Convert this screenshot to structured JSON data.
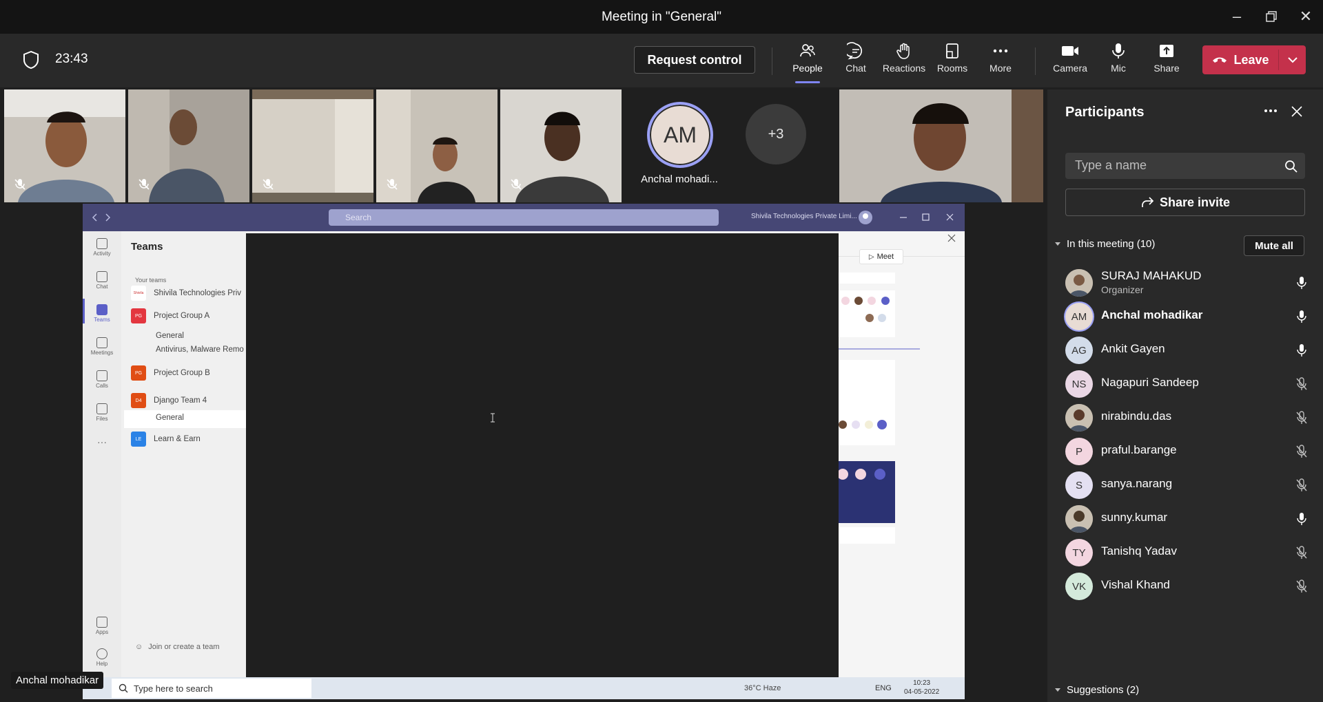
{
  "window": {
    "title": "Meeting in \"General\""
  },
  "meeting_bar": {
    "timer": "23:43",
    "request_control": "Request control",
    "tools": [
      {
        "label": "People"
      },
      {
        "label": "Chat"
      },
      {
        "label": "Reactions"
      },
      {
        "label": "Rooms"
      },
      {
        "label": "More"
      }
    ],
    "devices": [
      {
        "label": "Camera"
      },
      {
        "label": "Mic"
      },
      {
        "label": "Share"
      }
    ],
    "leave": "Leave"
  },
  "video_strip": {
    "avatar_initials": "AM",
    "avatar_name": "Anchal mohadi...",
    "overflow": "+3"
  },
  "shared_screen": {
    "search_placeholder": "Search",
    "org": "Shivila Technologies Private Limi...",
    "rail": [
      "Activity",
      "Chat",
      "Teams",
      "Meetings",
      "Calls",
      "Files",
      "Apps",
      "Help"
    ],
    "teams_header": "Teams",
    "your_teams": "Your teams",
    "teams": [
      {
        "name": "Shivila Technologies Priv",
        "badge": "Shivila",
        "color": "#ffffff"
      },
      {
        "name": "Project Group A",
        "badge": "PG",
        "color": "#e3363f"
      },
      {
        "name": "Project Group B",
        "badge": "PG",
        "color": "#e04d14"
      },
      {
        "name": "Django Team 4",
        "badge": "D4",
        "color": "#e04d14"
      },
      {
        "name": "Learn & Earn",
        "badge": "LE",
        "color": "#2a82e6"
      }
    ],
    "channels": [
      "General",
      "Antivirus, Malware Remo",
      "General"
    ],
    "join_team": "Join or create a team",
    "meet": "Meet",
    "taskbar_search": "Type here to search",
    "weather": "36°C Haze",
    "lang": "ENG",
    "time": "10:23",
    "date": "04-05-2022"
  },
  "participants": {
    "title": "Participants",
    "search_placeholder": "Type a name",
    "share_invite": "Share invite",
    "in_meeting": "In this meeting (10)",
    "mute_all": "Mute all",
    "people": [
      {
        "name": "SURAJ MAHAKUD",
        "role": "Organizer",
        "initials": "",
        "mic": "on"
      },
      {
        "name": "Anchal mohadikar",
        "role": "",
        "initials": "AM",
        "mic": "on"
      },
      {
        "name": "Ankit Gayen",
        "role": "",
        "initials": "AG",
        "mic": "on"
      },
      {
        "name": "Nagapuri Sandeep",
        "role": "",
        "initials": "NS",
        "mic": "off"
      },
      {
        "name": "nirabindu.das",
        "role": "",
        "initials": "",
        "mic": "off"
      },
      {
        "name": "praful.barange",
        "role": "",
        "initials": "P",
        "mic": "off"
      },
      {
        "name": "sanya.narang",
        "role": "",
        "initials": "S",
        "mic": "off"
      },
      {
        "name": "sunny.kumar",
        "role": "",
        "initials": "",
        "mic": "on"
      },
      {
        "name": "Tanishq Yadav",
        "role": "",
        "initials": "TY",
        "mic": "off"
      },
      {
        "name": "Vishal Khand",
        "role": "",
        "initials": "VK",
        "mic": "off"
      }
    ],
    "suggestions": "Suggestions (2)"
  },
  "presenter_tag": "Anchal mohadikar"
}
